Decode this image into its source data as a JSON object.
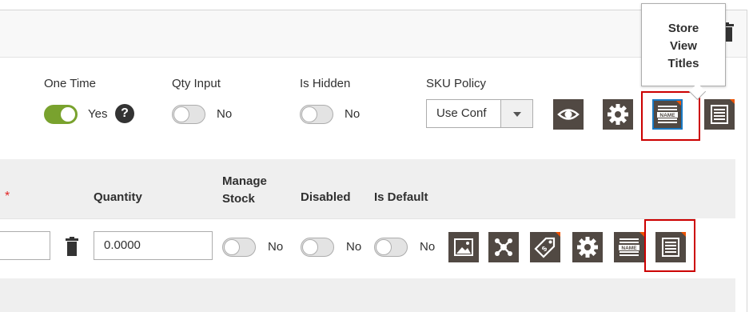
{
  "options": {
    "one_time": {
      "label": "One Time",
      "value": "Yes"
    },
    "qty_input": {
      "label": "Qty Input",
      "value": "No"
    },
    "is_hidden": {
      "label": "Is Hidden",
      "value": "No"
    },
    "sku_policy": {
      "label": "SKU Policy",
      "selected": "Use Conf"
    },
    "help": "?"
  },
  "tooltip": {
    "line1": "Store",
    "line2": "View",
    "line3": "Titles"
  },
  "grid": {
    "required_mark": "*",
    "headers": {
      "quantity": "Quantity",
      "manage_stock_1": "Manage",
      "manage_stock_2": "Stock",
      "disabled": "Disabled",
      "is_default": "Is Default"
    },
    "row": {
      "quantity": "0.0000",
      "manage_stock": "No",
      "disabled": "No",
      "is_default": "No"
    }
  },
  "icons": {
    "top": [
      "eye-icon",
      "gear-icon",
      "name-icon",
      "document-icon"
    ],
    "row": [
      "image-icon",
      "network-icon",
      "price-tag-icon",
      "gear-icon",
      "name-icon",
      "document-icon"
    ]
  },
  "colors": {
    "accent_green": "#79a22e",
    "button_bg": "#514943",
    "highlight_red": "#cc0000",
    "badge_orange": "#eb5202"
  }
}
